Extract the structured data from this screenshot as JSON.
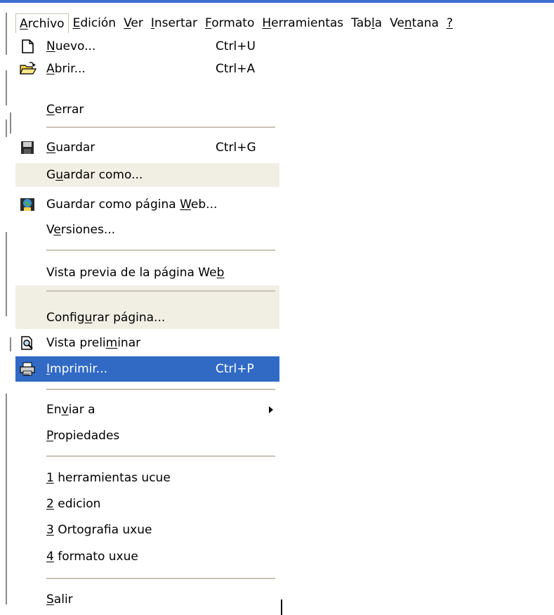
{
  "menubar": {
    "items": [
      {
        "pre": "",
        "u": "A",
        "post": "rchivo"
      },
      {
        "pre": "",
        "u": "E",
        "post": "dición"
      },
      {
        "pre": "",
        "u": "V",
        "post": "er"
      },
      {
        "pre": "",
        "u": "I",
        "post": "nsertar"
      },
      {
        "pre": "",
        "u": "F",
        "post": "ormato"
      },
      {
        "pre": "",
        "u": "H",
        "post": "erramientas"
      },
      {
        "pre": "Tab",
        "u": "l",
        "post": "a"
      },
      {
        "pre": "Ve",
        "u": "n",
        "post": "tana"
      },
      {
        "pre": "",
        "u": "?",
        "post": ""
      }
    ]
  },
  "menu": {
    "nuevo": {
      "pre": "",
      "u": "N",
      "post": "uevo...",
      "shortcut": "Ctrl+U",
      "icon": "new-document-icon"
    },
    "abrir": {
      "pre": "",
      "u": "A",
      "post": "brir...",
      "shortcut": "Ctrl+A",
      "icon": "open-folder-icon"
    },
    "cerrar": {
      "pre": "",
      "u": "C",
      "post": "errar"
    },
    "guardar": {
      "pre": "",
      "u": "G",
      "post": "uardar",
      "shortcut": "Ctrl+G",
      "icon": "floppy-disk-icon"
    },
    "guardar_como": {
      "pre": "G",
      "u": "u",
      "post": "ardar como..."
    },
    "guardar_web": {
      "pre": "Guardar como página ",
      "u": "W",
      "post": "eb...",
      "icon": "save-web-icon"
    },
    "versiones": {
      "pre": "V",
      "u": "e",
      "post": "rsiones..."
    },
    "vista_previa_web": {
      "pre": "Vista previa de la página We",
      "u": "b",
      "post": ""
    },
    "configurar": {
      "pre": "Config",
      "u": "u",
      "post": "rar página..."
    },
    "vista_preliminar": {
      "pre": "Vista preli",
      "u": "m",
      "post": "inar",
      "icon": "print-preview-icon"
    },
    "imprimir": {
      "pre": "",
      "u": "I",
      "post": "mprimir...",
      "shortcut": "Ctrl+P",
      "icon": "printer-icon"
    },
    "enviar": {
      "pre": "En",
      "u": "v",
      "post": "iar a"
    },
    "propiedades": {
      "pre": "",
      "u": "P",
      "post": "ropiedades"
    },
    "recent": [
      {
        "pre": "",
        "u": "1",
        "post": " herramientas ucue"
      },
      {
        "pre": "",
        "u": "2",
        "post": " edicion"
      },
      {
        "pre": "",
        "u": "3",
        "post": " Ortografia uxue"
      },
      {
        "pre": "",
        "u": "4",
        "post": " formato uxue"
      }
    ],
    "salir": {
      "pre": "",
      "u": "S",
      "post": "alir"
    }
  },
  "colors": {
    "highlight": "#316ac5",
    "accent_bar": "#3f6dd1",
    "hover_band": "#f1efe4"
  }
}
